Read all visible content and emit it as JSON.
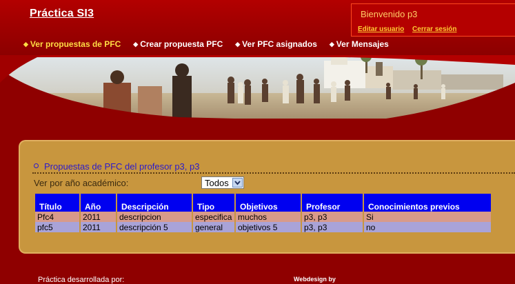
{
  "header": {
    "site_title": "Práctica SI3",
    "welcome": "Bienvenido p3",
    "links": [
      "Editar usuario",
      "Cerrar sesión"
    ]
  },
  "nav": {
    "items": [
      {
        "label": "Ver propuestas de PFC",
        "active": true
      },
      {
        "label": "Crear propuesta PFC",
        "active": false
      },
      {
        "label": "Ver PFC asignados",
        "active": false
      },
      {
        "label": "Ver Mensajes",
        "active": false
      }
    ]
  },
  "content": {
    "title": "Propuestas de PFC del profesor p3, p3",
    "filter_label": "Ver por año académico:",
    "filter_value": "Todos",
    "table": {
      "headers": [
        "Título",
        "Año",
        "Descripción",
        "Tipo",
        "Objetivos",
        "Profesor",
        "Conocimientos previos"
      ],
      "rows": [
        [
          "Pfc4",
          "2011",
          "descripcion",
          "especifica",
          "muchos",
          "p3, p3",
          "Si"
        ],
        [
          "pfc5",
          "2011",
          "descripción 5",
          "general",
          "objetivos 5",
          "p3, p3",
          "no"
        ]
      ]
    }
  },
  "footer": {
    "left": "Práctica desarrollada por:",
    "right": "Webdesign by"
  },
  "colors": {
    "background": "#8f0000",
    "panel": "#c8963e",
    "table_header": "#0000f0",
    "row_a": "#d89a8a",
    "row_b": "#a9a3d8",
    "link": "#ffcc33"
  }
}
